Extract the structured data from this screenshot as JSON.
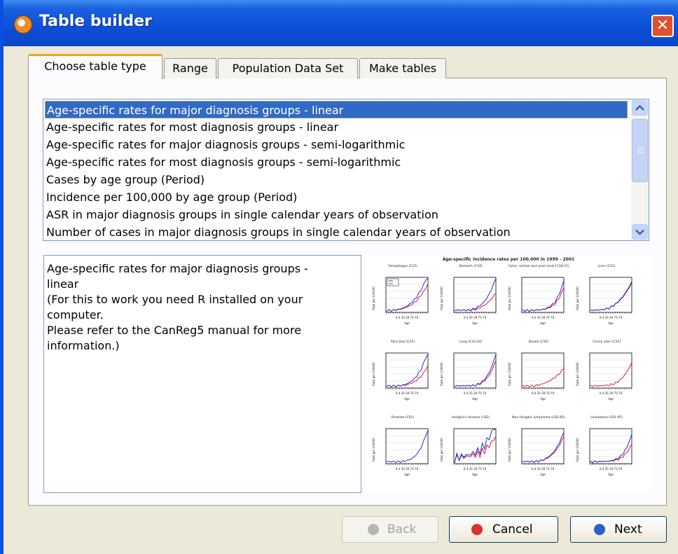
{
  "window": {
    "title": "Table builder",
    "close_glyph": "✕"
  },
  "tabs": [
    {
      "label": "Choose table type",
      "active": true
    },
    {
      "label": "Range",
      "active": false
    },
    {
      "label": "Population Data Set",
      "active": false
    },
    {
      "label": "Make tables",
      "active": false
    }
  ],
  "table_types": [
    {
      "label": "Age-specific rates for major diagnosis groups - linear",
      "selected": true
    },
    {
      "label": "Age-specific rates for most diagnosis groups - linear",
      "selected": false
    },
    {
      "label": "Age-specific rates for major diagnosis groups - semi-logarithmic",
      "selected": false
    },
    {
      "label": "Age-specific rates for most diagnosis groups - semi-logarithmic",
      "selected": false
    },
    {
      "label": "Cases by age group (Period)",
      "selected": false
    },
    {
      "label": "Incidence per 100,000 by age group (Period)",
      "selected": false
    },
    {
      "label": "ASR in major diagnosis groups in single calendar years of observation",
      "selected": false
    },
    {
      "label": "Number of cases in major diagnosis groups in single calendar years of observation",
      "selected": false
    }
  ],
  "description": {
    "line1": "Age-specific rates for major diagnosis groups -",
    "line2": "linear",
    "line3": "(For this to work you need R installed on your",
    "line4": "computer.",
    "line5": "Please refer to the CanReg5 manual for more",
    "line6": "information.)"
  },
  "preview": {
    "title": "Age-specific incidence rates per 100,000 in 1999 - 2001",
    "panels": [
      "Oesophagus (C15)",
      "Stomach (C16)",
      "Colon, rectum and anal canal (C18-21)",
      "Liver (C22)",
      "Pancreas (C25)",
      "Lung (C33-34)",
      "Breast (C50)",
      "Cervix uteri (C53)",
      "Prostate (C61)",
      "Hodgkin's disease (C81)",
      "Non-Hodgkin lymphoma (C82-85)",
      "Leukaemia (C91-95)"
    ],
    "x_ticks": "0-4  35-39  75-79",
    "x_label": "Age",
    "y_label": "Rate per 100000",
    "legend": [
      "M",
      "F"
    ],
    "series_colors": {
      "male": "#1f2fe0",
      "female": "#e01f2f"
    }
  },
  "buttons": {
    "back": "Back",
    "cancel": "Cancel",
    "next": "Next"
  },
  "colors": {
    "selection": "#316ac5",
    "title_bar": "#0d4fd6",
    "tab_highlight": "#f2a22a"
  }
}
